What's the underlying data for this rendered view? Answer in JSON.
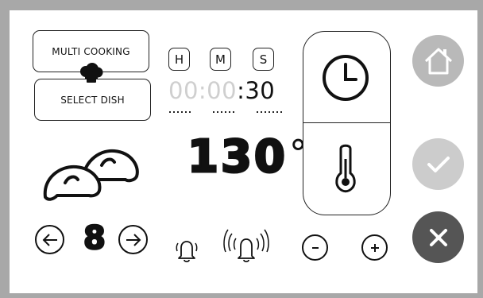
{
  "mode_buttons": {
    "multi_cooking": "MULTI COOKING",
    "select_dish": "SELECT DISH"
  },
  "time_units": {
    "hours": "H",
    "minutes": "M",
    "seconds": "S"
  },
  "timer": {
    "inactive": "00:00",
    "active": ":30"
  },
  "temperature": {
    "value": "130",
    "unit": "°"
  },
  "quantity": {
    "value": "8"
  },
  "icons": [
    "chef-hat-icon",
    "bread-rolls-icon",
    "arrow-left-icon",
    "arrow-right-icon",
    "bell-icon",
    "bell-ringing-icon",
    "clock-icon",
    "thermometer-icon",
    "minus-icon",
    "plus-icon",
    "home-icon",
    "check-icon",
    "close-icon"
  ],
  "colors": {
    "frame": "#a8a8a8",
    "home_button": "#b9b9b9",
    "confirm_button": "#cccccc",
    "cancel_button": "#555555",
    "timer_inactive": "#cfcfcf"
  }
}
